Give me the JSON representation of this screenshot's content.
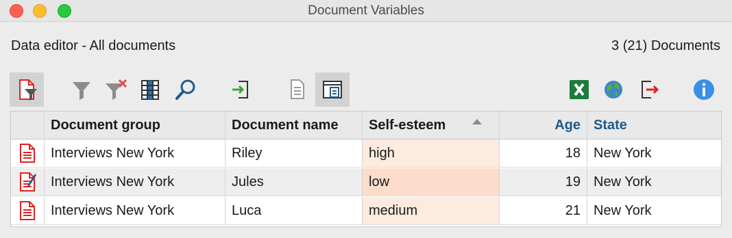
{
  "window": {
    "title": "Document Variables"
  },
  "header": {
    "subtitle": "Data editor - All documents",
    "doc_count": "3 (21) Documents"
  },
  "toolbar": {
    "icons": [
      "filter-document-icon",
      "filter-icon",
      "clear-filter-icon",
      "columns-icon",
      "search-icon",
      "import-icon",
      "list-view-icon",
      "variable-list-icon",
      "excel-icon",
      "web-icon",
      "export-icon",
      "info-icon"
    ]
  },
  "table": {
    "columns": [
      "Document group",
      "Document name",
      "Self-esteem",
      "Age",
      "State"
    ],
    "rows": [
      {
        "icon": "document-icon",
        "group": "Interviews New York",
        "name": "Riley",
        "self_esteem": "high",
        "age": "18",
        "state": "New York"
      },
      {
        "icon": "document-memo-icon",
        "group": "Interviews New York",
        "name": "Jules",
        "self_esteem": "low",
        "age": "19",
        "state": "New York"
      },
      {
        "icon": "document-icon",
        "group": "Interviews New York",
        "name": "Luca",
        "self_esteem": "medium",
        "age": "21",
        "state": "New York"
      }
    ]
  },
  "colors": {
    "accent_blue": "#1e5a8a",
    "doc_red": "#e02020",
    "excel_green": "#1d7b3c",
    "highlight": "#fcdcca"
  }
}
